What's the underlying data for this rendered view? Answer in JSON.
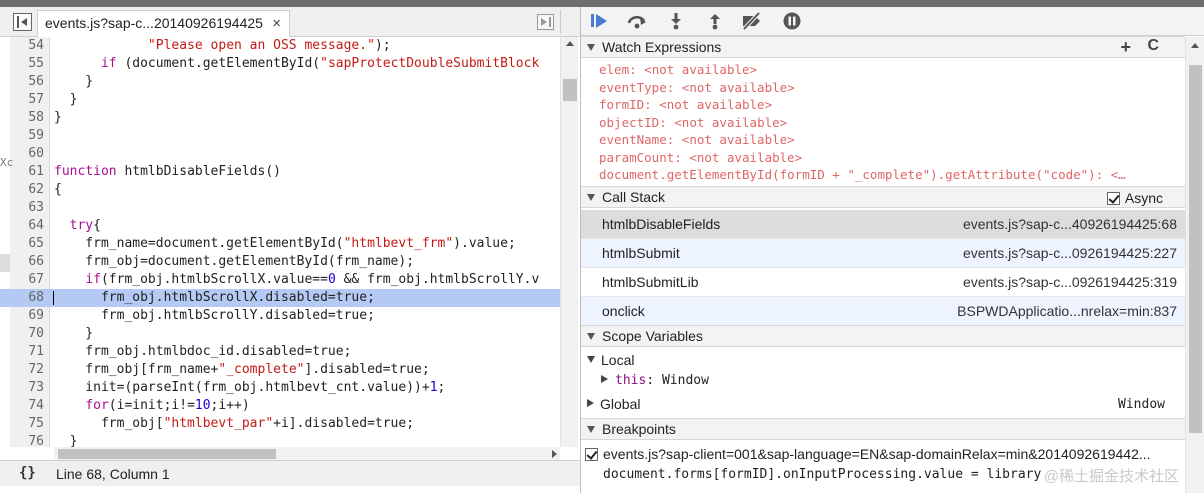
{
  "source": {
    "tab_label": "events.js?sap-c...20140926194425",
    "close_glyph": "×",
    "lines": [
      {
        "n": "54",
        "code": "            \"Please open an OSS message.\");"
      },
      {
        "n": "55",
        "code": "      if (document.getElementById(\"sapProtectDoubleSubmitBlock"
      },
      {
        "n": "56",
        "code": "    }"
      },
      {
        "n": "57",
        "code": "  }"
      },
      {
        "n": "58",
        "code": "}"
      },
      {
        "n": "59",
        "code": ""
      },
      {
        "n": "60",
        "code": ""
      },
      {
        "n": "61",
        "code": "function htmlbDisableFields()"
      },
      {
        "n": "62",
        "code": "{"
      },
      {
        "n": "63",
        "code": ""
      },
      {
        "n": "64",
        "code": "  try{"
      },
      {
        "n": "65",
        "code": "    frm_name=document.getElementById(\"htmlbevt_frm\").value;"
      },
      {
        "n": "66",
        "code": "    frm_obj=document.getElementById(frm_name);"
      },
      {
        "n": "67",
        "code": "    if(frm_obj.htmlbScrollX.value==0 && frm_obj.htmlbScrollY.v"
      },
      {
        "n": "68",
        "code": "      frm_obj.htmlbScrollX.disabled=true;"
      },
      {
        "n": "69",
        "code": "      frm_obj.htmlbScrollY.disabled=true;"
      },
      {
        "n": "70",
        "code": "    }"
      },
      {
        "n": "71",
        "code": "    frm_obj.htmlbdoc_id.disabled=true;"
      },
      {
        "n": "72",
        "code": "    frm_obj[frm_name+\"_complete\"].disabled=true;"
      },
      {
        "n": "73",
        "code": "    init=(parseInt(frm_obj.htmlbevt_cnt.value))+1;"
      },
      {
        "n": "74",
        "code": "    for(i=init;i!=10;i++)"
      },
      {
        "n": "75",
        "code": "      frm_obj[\"htmlbevt_par\"+i].disabled=true;"
      },
      {
        "n": "76",
        "code": "  }"
      }
    ],
    "highlighted_line": "68",
    "left_gutter_mark": "Xc",
    "pretty_print_label": "{}",
    "cursor_position": "Line 68, Column 1"
  },
  "debugger": {
    "watch": {
      "title": "Watch Expressions",
      "add_glyph": "+",
      "refresh_glyph": "C",
      "expressions": [
        {
          "name": "elem",
          "value": "<not available>"
        },
        {
          "name": "eventType",
          "value": "<not available>"
        },
        {
          "name": "formID",
          "value": "<not available>"
        },
        {
          "name": "objectID",
          "value": "<not available>"
        },
        {
          "name": "eventName",
          "value": "<not available>"
        },
        {
          "name": "paramCount",
          "value": "<not available>"
        },
        {
          "name": "document.getElementById(formID + \"_complete\").getAttribute(\"code\")",
          "value": "<…"
        }
      ]
    },
    "call_stack": {
      "title": "Call Stack",
      "async_label": "Async",
      "frames": [
        {
          "fn": "htmlbDisableFields",
          "loc": "events.js?sap-c...40926194425:68"
        },
        {
          "fn": "htmlbSubmit",
          "loc": "events.js?sap-c...0926194425:227"
        },
        {
          "fn": "htmlbSubmitLib",
          "loc": "events.js?sap-c...0926194425:319"
        },
        {
          "fn": "onclick",
          "loc": "BSPWDApplicatio...nrelax=min:837"
        }
      ]
    },
    "scope": {
      "title": "Scope Variables",
      "local_label": "Local",
      "this_name": "this",
      "this_value": "Window",
      "global_label": "Global",
      "global_value": "Window"
    },
    "breakpoints": {
      "title": "Breakpoints",
      "file": "events.js?sap-client=001&sap-language=EN&sap-domainRelax=min&2014092619442...",
      "code": "document.forms[formID].onInputProcessing.value = library"
    },
    "watermark": "@稀土掘金技术社区"
  },
  "colors": {
    "highlight": "#b4c9f4",
    "selected_frame": "#dcdcdc",
    "alt_frame": "#edf3ff",
    "watch_text": "#c80000",
    "keyword": "#aa0d91",
    "string": "#c41a16",
    "number": "#1c00cf",
    "resume_blue": "#4a7bd5"
  }
}
